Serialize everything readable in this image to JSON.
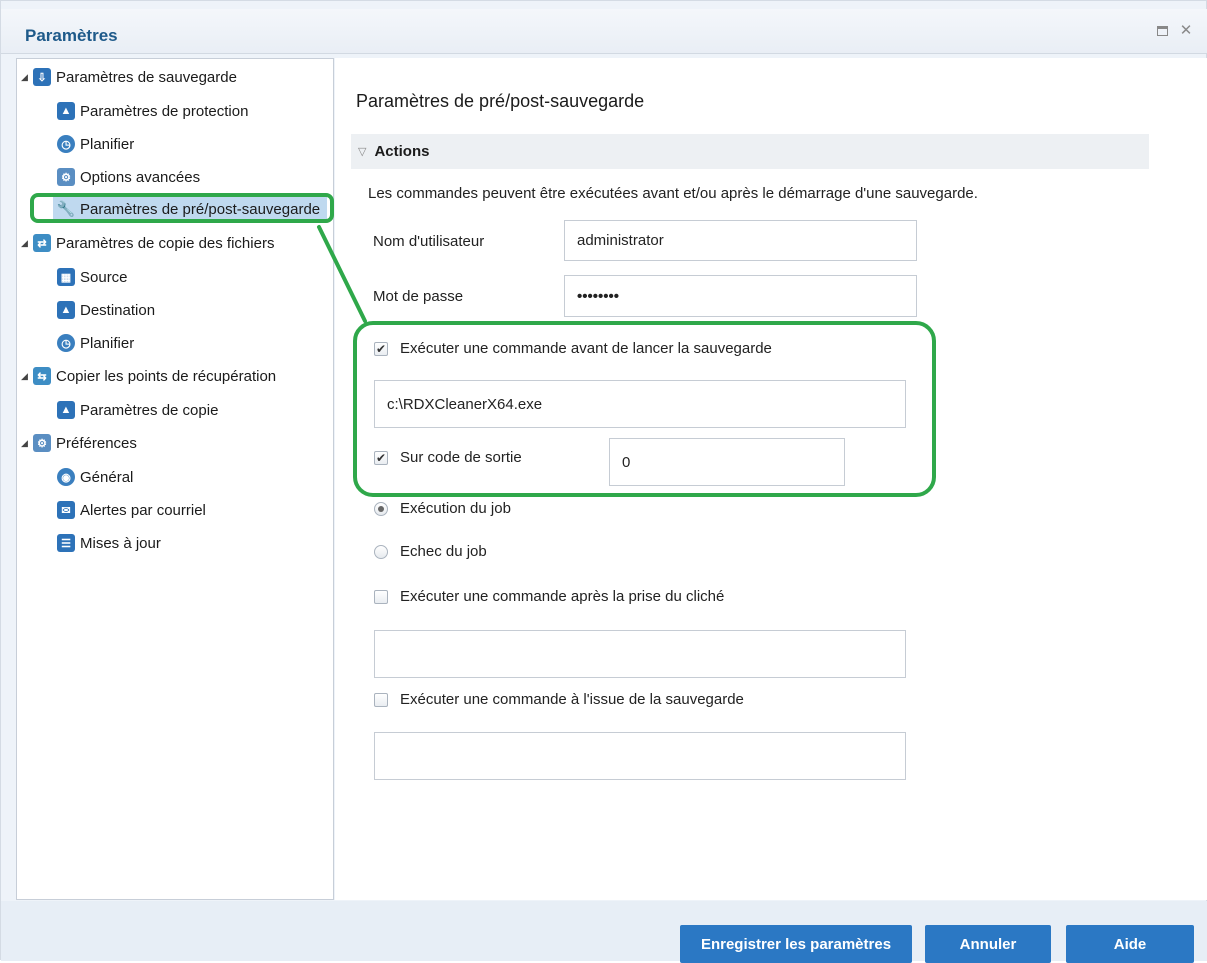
{
  "window": {
    "title": "Paramètres"
  },
  "tree": {
    "items": [
      {
        "label": "Paramètres de sauvegarde",
        "icon": "backup-settings-icon"
      },
      {
        "label": "Paramètres de protection",
        "icon": "protection-icon"
      },
      {
        "label": "Planifier",
        "icon": "schedule-icon"
      },
      {
        "label": "Options avancées",
        "icon": "advanced-options-icon"
      },
      {
        "label": "Paramètres de pré/post-sauvegarde",
        "icon": "wrench-icon",
        "selected": true
      },
      {
        "label": "Paramètres de copie des fichiers",
        "icon": "file-copy-icon"
      },
      {
        "label": "Source",
        "icon": "source-icon"
      },
      {
        "label": "Destination",
        "icon": "destination-icon"
      },
      {
        "label": "Planifier",
        "icon": "schedule-icon"
      },
      {
        "label": "Copier les points de récupération",
        "icon": "recovery-points-icon"
      },
      {
        "label": "Paramètres de copie",
        "icon": "copy-settings-icon"
      },
      {
        "label": "Préférences",
        "icon": "preferences-icon"
      },
      {
        "label": "Général",
        "icon": "general-icon"
      },
      {
        "label": "Alertes par courriel",
        "icon": "email-alert-icon"
      },
      {
        "label": "Mises à jour",
        "icon": "updates-icon"
      }
    ]
  },
  "main": {
    "page_title": "Paramètres de pré/post-sauvegarde",
    "section_title": "Actions",
    "description": "Les commandes peuvent être exécutées avant et/ou après le démarrage d'une sauvegarde.",
    "username_label": "Nom d'utilisateur",
    "username_value": "administrator",
    "password_label": "Mot de passe",
    "password_value": "••••••••",
    "before_cmd_label": "Exécuter une commande avant de lancer la sauvegarde",
    "before_cmd_checked": true,
    "before_cmd_value": "c:\\RDXCleanerX64.exe",
    "exit_code_label": "Sur code de sortie",
    "exit_code_checked": true,
    "exit_code_value": "0",
    "radio_run_job": "Exécution du job",
    "radio_fail_job": "Echec du job",
    "after_snapshot_label": "Exécuter une commande après la prise du cliché",
    "after_snapshot_value": "",
    "after_backup_label": "Exécuter une commande à l'issue de la sauvegarde",
    "after_backup_value": ""
  },
  "footer": {
    "save_label": "Enregistrer les paramètres",
    "cancel_label": "Annuler",
    "help_label": "Aide"
  },
  "colors": {
    "accent": "#2b78c4",
    "annotation": "#2fa84a",
    "title": "#1e5a8a"
  }
}
